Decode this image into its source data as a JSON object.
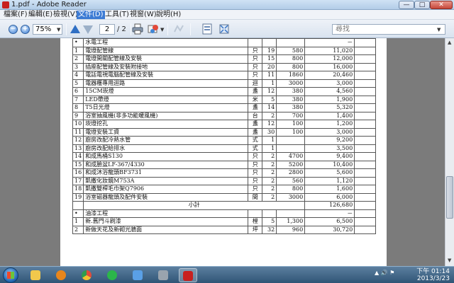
{
  "window": {
    "title": "1.pdf - Adobe Reader",
    "controls": {
      "minimize": "—",
      "maximize": "□",
      "close": "✕"
    }
  },
  "menu": {
    "items": [
      {
        "label": "檔案(F)"
      },
      {
        "label": "編輯(E)"
      },
      {
        "label": "檢視(V)"
      },
      {
        "label": "文件(D)"
      },
      {
        "label": "工具(T)"
      },
      {
        "label": "視窗(W)"
      },
      {
        "label": "說明(H)"
      }
    ],
    "active_index": 3
  },
  "toolbar": {
    "zoom_out_icon": "−",
    "zoom_in_icon": "+",
    "zoom_value": "75%",
    "page_current": "2",
    "page_total": "/ 2",
    "search_placeholder": "尋找"
  },
  "table": {
    "sections": [
      {
        "marker": "•",
        "title": "水電工程",
        "amount": "－",
        "rows": [
          {
            "no": "1",
            "name": "電燈配管線",
            "unit": "只",
            "qty": "19",
            "price": "580",
            "amount": "11,020"
          },
          {
            "no": "2",
            "name": "電燈開關配管線及安裝",
            "unit": "只",
            "qty": "15",
            "price": "800",
            "amount": "12,000"
          },
          {
            "no": "3",
            "name": "插座配管線及安裝附接地",
            "unit": "只",
            "qty": "20",
            "price": "800",
            "amount": "16,000"
          },
          {
            "no": "4",
            "name": "電話電視電腦配管線及安裝",
            "unit": "只",
            "qty": "11",
            "price": "1860",
            "amount": "20,460"
          },
          {
            "no": "5",
            "name": "電器穫專用迴路",
            "unit": "迴",
            "qty": "1",
            "price": "3000",
            "amount": "3,000"
          },
          {
            "no": "6",
            "name": "15CM崁燈",
            "unit": "盞",
            "qty": "12",
            "price": "380",
            "amount": "4,560"
          },
          {
            "no": "7",
            "name": "LED帶燈",
            "unit": "米",
            "qty": "5",
            "price": "380",
            "amount": "1,900"
          },
          {
            "no": "8",
            "name": "T5日光燈",
            "unit": "盞",
            "qty": "14",
            "price": "380",
            "amount": "5,320"
          },
          {
            "no": "9",
            "name": "浴室抽風機(非多功能暖風機)",
            "unit": "台",
            "qty": "2",
            "price": "700",
            "amount": "1,400"
          },
          {
            "no": "10",
            "name": "崁燈挖孔",
            "unit": "盞",
            "qty": "12",
            "price": "100",
            "amount": "1,200"
          },
          {
            "no": "11",
            "name": "電燈安裝工資",
            "unit": "盞",
            "qty": "30",
            "price": "100",
            "amount": "3,000"
          },
          {
            "no": "12",
            "name": "廚房改配冷熱水管",
            "unit": "式",
            "qty": "1",
            "price": "",
            "amount": "9,200"
          },
          {
            "no": "13",
            "name": "廚房改配給排水",
            "unit": "式",
            "qty": "1",
            "price": "",
            "amount": "3,500"
          },
          {
            "no": "14",
            "name": "和成馬桶S130",
            "unit": "只",
            "qty": "2",
            "price": "4700",
            "amount": "9,400"
          },
          {
            "no": "15",
            "name": "和成臉盆LF-367/4330",
            "unit": "只",
            "qty": "2",
            "price": "5200",
            "amount": "10,400"
          },
          {
            "no": "16",
            "name": "和成沐浴龍頭BF3731",
            "unit": "只",
            "qty": "2",
            "price": "2800",
            "amount": "5,600"
          },
          {
            "no": "17",
            "name": "凱撒化妝鏡M753A",
            "unit": "只",
            "qty": "2",
            "price": "560",
            "amount": "1,120"
          },
          {
            "no": "18",
            "name": "凱撒雙桿毛巾架Q7906",
            "unit": "只",
            "qty": "2",
            "price": "800",
            "amount": "1,600"
          },
          {
            "no": "19",
            "name": "浴室磁器龍頭及配件安裝",
            "unit": "間",
            "qty": "2",
            "price": "3000",
            "amount": "6,000"
          }
        ],
        "subtotal_label": "小計",
        "subtotal_amount": "126,680"
      },
      {
        "marker": "•",
        "title": "油漆工程",
        "amount": "－",
        "rows": [
          {
            "no": "1",
            "name": "新.舊門斗刷漆",
            "unit": "樘",
            "qty": "5",
            "price": "1,300",
            "amount": "6,500"
          },
          {
            "no": "2",
            "name": "新做天花及新砌光牆面",
            "unit": "坪",
            "qty": "32",
            "price": "960",
            "amount": "30,720"
          }
        ]
      }
    ]
  },
  "taskbar": {
    "tray_text": "▲ 🔊 ⚑",
    "time": "下午 01:14",
    "date": "2013/3/23"
  },
  "colors": {
    "accent": "#3d7bd4",
    "acrobat_red": "#c8201f",
    "taskbar": "#2f5576"
  }
}
